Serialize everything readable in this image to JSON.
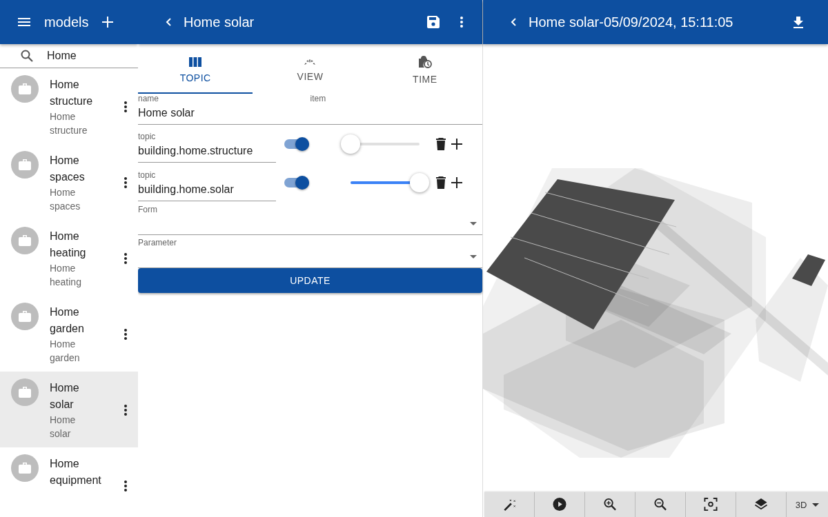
{
  "sidebar": {
    "title": "models",
    "search": {
      "value": "Home"
    },
    "items": [
      {
        "title": "Home structure",
        "subtitle": "Home structure",
        "selected": false
      },
      {
        "title": "Home spaces",
        "subtitle": "Home spaces",
        "selected": false
      },
      {
        "title": "Home heating",
        "subtitle": "Home heating",
        "selected": false
      },
      {
        "title": "Home garden",
        "subtitle": "Home garden",
        "selected": false
      },
      {
        "title": "Home solar",
        "subtitle": "Home solar",
        "selected": true
      },
      {
        "title": "Home equipment",
        "selected": false
      }
    ]
  },
  "editor": {
    "title": "Home solar",
    "tabs": [
      {
        "label": "TOPIC",
        "selected": true
      },
      {
        "label": "VIEW",
        "selected": false
      },
      {
        "label": "TIME",
        "selected": false
      }
    ],
    "name_field": {
      "label": "name",
      "value": "Home solar"
    },
    "item_field": {
      "label": "item"
    },
    "topics": [
      {
        "label": "topic",
        "value": "building.home.structure",
        "on": true,
        "level": 0
      },
      {
        "label": "topic",
        "value": "building.home.solar",
        "on": true,
        "level": 1
      }
    ],
    "selects": [
      {
        "label": "Form"
      },
      {
        "label": "Parameter"
      }
    ],
    "button": "UPDATE"
  },
  "viewer": {
    "title": "Home solar-05/09/2024, 15:11:05",
    "mode": "3D"
  }
}
